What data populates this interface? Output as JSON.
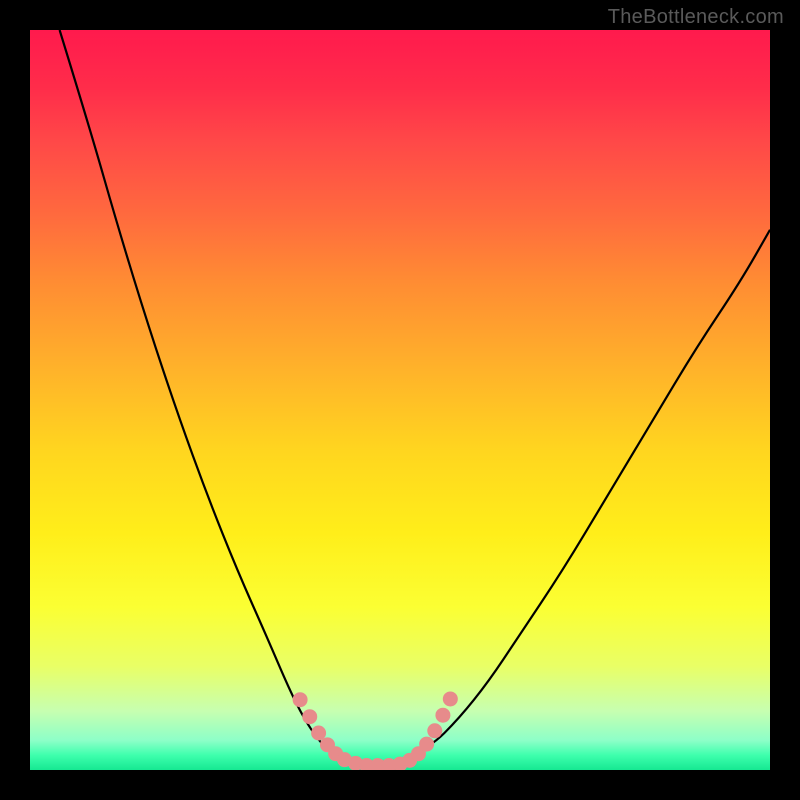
{
  "watermark": "TheBottleneck.com",
  "colors": {
    "frame_background": "#000000",
    "curve_stroke": "#000000",
    "marker_fill": "#e78b8b",
    "marker_stroke": "#d97878"
  },
  "chart_data": {
    "type": "line",
    "title": "",
    "xlabel": "",
    "ylabel": "",
    "xlim": [
      0,
      100
    ],
    "ylim": [
      0,
      100
    ],
    "note": "No axis ticks or numeric labels are visible; values are positional estimates on a 0–100 scale.",
    "series": [
      {
        "name": "left-curve",
        "x": [
          4,
          8,
          12,
          16,
          20,
          24,
          28,
          32,
          35,
          37,
          39,
          41,
          43
        ],
        "y": [
          100,
          87,
          73,
          60,
          48,
          37,
          27,
          18,
          11,
          7,
          4,
          2,
          1
        ]
      },
      {
        "name": "right-curve",
        "x": [
          50,
          54,
          58,
          62,
          66,
          72,
          78,
          84,
          90,
          96,
          100
        ],
        "y": [
          1,
          3,
          7,
          12,
          18,
          27,
          37,
          47,
          57,
          66,
          73
        ]
      },
      {
        "name": "valley-floor",
        "x": [
          43,
          46,
          50
        ],
        "y": [
          1,
          0.5,
          1
        ]
      }
    ],
    "markers": {
      "name": "highlight-dots",
      "points": [
        {
          "x": 36.5,
          "y": 9.5
        },
        {
          "x": 37.8,
          "y": 7.2
        },
        {
          "x": 39.0,
          "y": 5.0
        },
        {
          "x": 40.2,
          "y": 3.4
        },
        {
          "x": 41.3,
          "y": 2.2
        },
        {
          "x": 42.5,
          "y": 1.4
        },
        {
          "x": 44.0,
          "y": 0.9
        },
        {
          "x": 45.5,
          "y": 0.6
        },
        {
          "x": 47.0,
          "y": 0.6
        },
        {
          "x": 48.5,
          "y": 0.6
        },
        {
          "x": 50.0,
          "y": 0.8
        },
        {
          "x": 51.3,
          "y": 1.3
        },
        {
          "x": 52.5,
          "y": 2.2
        },
        {
          "x": 53.6,
          "y": 3.5
        },
        {
          "x": 54.7,
          "y": 5.3
        },
        {
          "x": 55.8,
          "y": 7.4
        },
        {
          "x": 56.8,
          "y": 9.6
        }
      ]
    }
  }
}
